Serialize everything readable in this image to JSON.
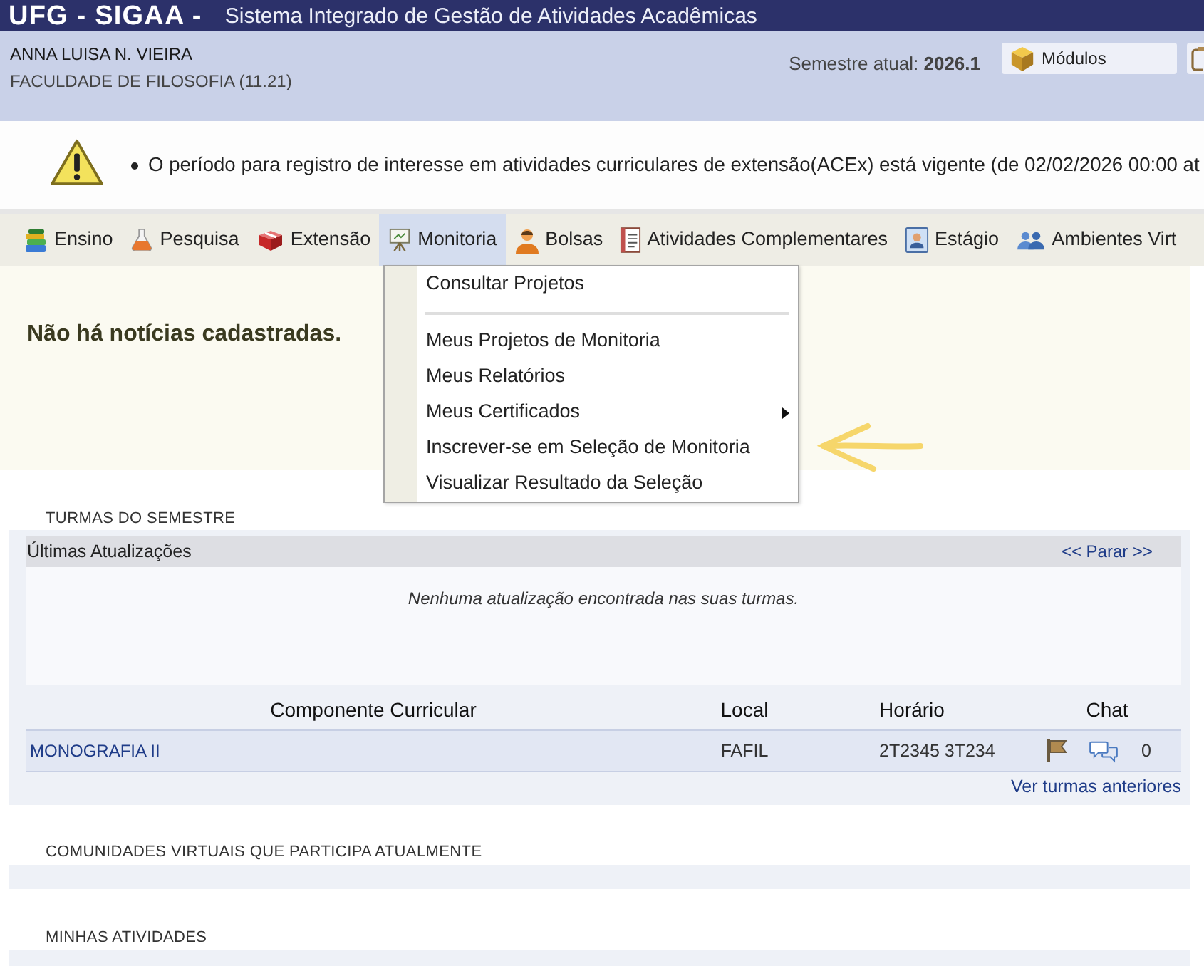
{
  "header": {
    "brand": "UFG - SIGAA -",
    "system_title": "Sistema Integrado de Gestão de Atividades Acadêmicas"
  },
  "user_bar": {
    "user_name": "ANNA LUISA N. VIEIRA",
    "unit": "FACULDADE DE FILOSOFIA (11.21)",
    "semester": "Semestre atual: **2026.1**",
    "modules_button": "Módulos"
  },
  "notice": {
    "items": [
      "O período para registro de interesse em atividades curriculares de extensão(ACEx) está vigente (de 02/02/2026 00:00 at"
    ]
  },
  "menu": [
    {
      "label": "Ensino",
      "selected": false
    },
    {
      "label": "Pesquisa",
      "selected": false
    },
    {
      "label": "Extensão",
      "selected": false
    },
    {
      "label": "Monitoria",
      "selected": true
    },
    {
      "label": "Bolsas",
      "selected": false
    },
    {
      "label": "Atividades Complementares",
      "selected": false
    },
    {
      "label": "Estágio",
      "selected": false
    },
    {
      "label": "Ambientes Virt",
      "selected": false
    }
  ],
  "dropdown": {
    "items": [
      {
        "kind": "item",
        "label": "Consultar Projetos"
      },
      {
        "kind": "separator"
      },
      {
        "kind": "item",
        "label": "Meus Projetos de Monitoria"
      },
      {
        "kind": "item",
        "label": "Meus Relatórios"
      },
      {
        "kind": "submenu",
        "label": "Meus Certificados"
      },
      {
        "kind": "item",
        "label": "Inscrever-se em Seleção de Monitoria"
      },
      {
        "kind": "item",
        "label": "Visualizar Resultado da Seleção"
      }
    ]
  },
  "news": {
    "message": "Não há notícias cadastradas."
  },
  "classes": {
    "title": "TURMAS DO SEMESTRE",
    "updates": {
      "title": "Últimas Atualizações",
      "stop_link": "<< Parar >>",
      "empty_message": "Nenhuma atualização encontrada nas suas turmas."
    },
    "table": {
      "columns": [
        "Componente Curricular",
        "Local",
        "Horário",
        "Chat"
      ],
      "rows": [
        {
          "component": "MONOGRAFIA II",
          "location": "FAFIL",
          "schedule": "2T2345 3T234",
          "chat_count": "0"
        }
      ]
    },
    "previous_link": "Ver turmas anteriores"
  },
  "sections": [
    {
      "title": "COMUNIDADES VIRTUAIS QUE PARTICIPA ATUALMENTE"
    },
    {
      "title": "MINHAS ATIVIDADES"
    }
  ]
}
